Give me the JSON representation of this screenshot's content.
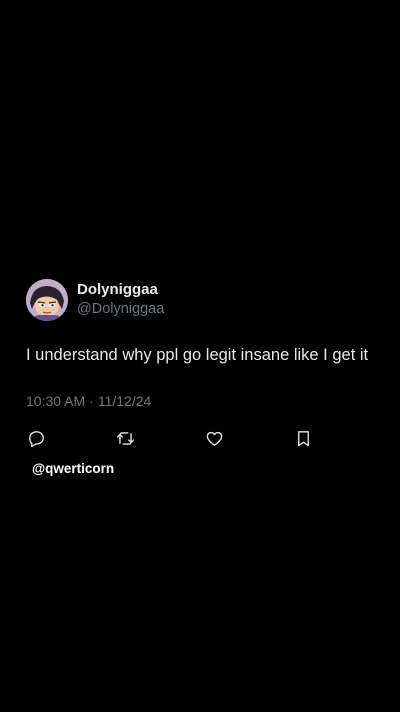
{
  "tweet": {
    "author": {
      "display_name": "Dolyniggaa",
      "handle": "@Dolyniggaa",
      "avatar_icon": "cartoon-avatar"
    },
    "text": "I understand why ppl go legit insane like I get it",
    "time": "10:30 AM",
    "separator": "·",
    "date": "11/12/24",
    "actions": {
      "reply_icon": "reply-icon",
      "retweet_icon": "retweet-icon",
      "like_icon": "heart-icon",
      "bookmark_icon": "bookmark-icon"
    }
  },
  "watermark": "@qwerticorn",
  "colors": {
    "background": "#000000",
    "primary_text": "#e7e9ea",
    "secondary_text": "#71767b"
  }
}
